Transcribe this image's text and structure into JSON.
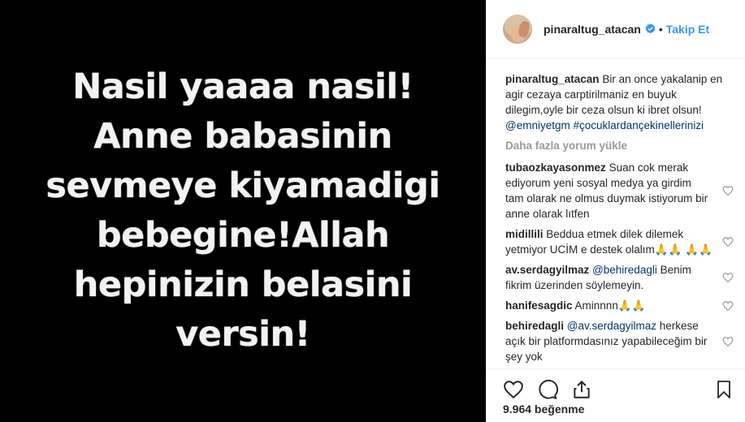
{
  "media": {
    "text": "Nasil yaaaa nasil!\nAnne babasinin\nsevmeye kiyamadigi\nbebegine!Allah\nhepinizin belasini\nversin!"
  },
  "header": {
    "username": "pinaraltug_atacan",
    "dot": "•",
    "follow_label": "Takip Et",
    "avatar_icon": "avatar-photo",
    "verified_icon": "verified-badge-icon"
  },
  "caption": {
    "username": "pinaraltug_atacan",
    "text": "Bir an once yakalanip en agir cezaya carptirilmaniz en buyuk dilegim,oyle bir ceza olsun ki ibret olsun!",
    "tags": "@emniyetgm #çocuklardançekinellerinizi"
  },
  "load_more": "Daha fazla yorum yükle",
  "comments": [
    {
      "username": "tubaozkayasonmez",
      "text": "Suan cok merak ediyorum yeni sosyal medya ya girdim tam olarak ne olmus duymak istiyorum bir anne olarak lıtfen"
    },
    {
      "username": "midillili",
      "text": "Beddua etmek dilek dilemek yetmiyor UCİM e destek olalım🙏🙏 🙏🙏"
    },
    {
      "username": "av.serdagyilmaz",
      "mention": "@behiredagli",
      "text": " Benim fikrim üzerinden söylemeyin."
    },
    {
      "username": "hanifesagdic",
      "text": "Aminnnn🙏🙏"
    },
    {
      "username": "behiredagli",
      "mention": "@av.serdagyilmaz",
      "text": " herkese açık bir platformdasınız yapabileceğim bir şey yok"
    }
  ],
  "actions": {
    "like_icon": "heart-icon",
    "comment_icon": "comment-icon",
    "share_icon": "share-icon",
    "save_icon": "bookmark-icon"
  },
  "likes": "9.964 beğenme",
  "colors": {
    "link": "#003569",
    "follow": "#3897f0",
    "verified": "#3897f0",
    "muted": "#999999"
  }
}
